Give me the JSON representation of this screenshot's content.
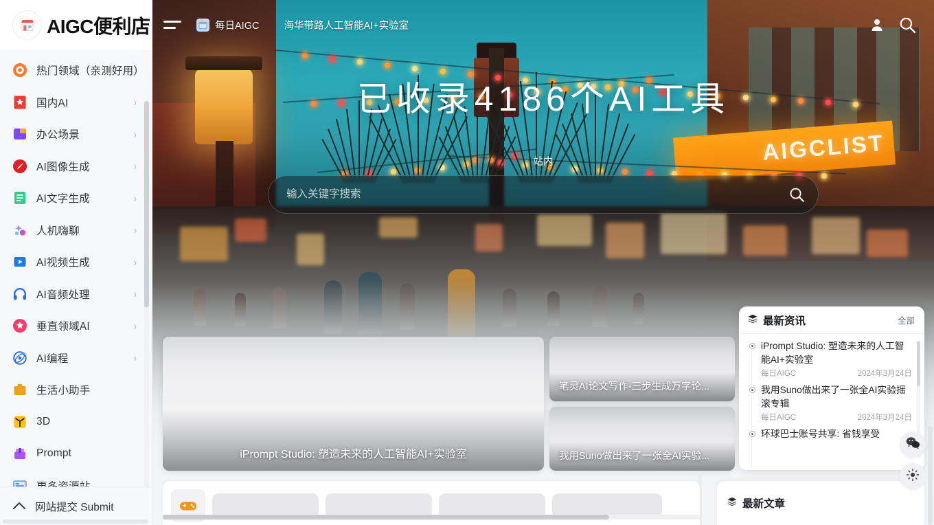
{
  "brand": {
    "logo_icon": "storefront-icon",
    "name": "AIGC便利店"
  },
  "sidebar": {
    "items": [
      {
        "label": "热门领域（亲测好用）",
        "icon": "hot-target-icon",
        "color": "#ff7a2f",
        "chevron": "›",
        "has_chevron": false
      },
      {
        "label": "国内AI",
        "icon": "star-bookmark-icon",
        "color": "#ef3b35",
        "chevron": "›",
        "has_chevron": true
      },
      {
        "label": "办公场景",
        "icon": "folder-icon",
        "color": "#7b4df0",
        "chevron": "›",
        "has_chevron": true
      },
      {
        "label": "AI图像生成",
        "icon": "paintbrush-icon",
        "color": "#e01f25",
        "chevron": "›",
        "has_chevron": true
      },
      {
        "label": "AI文字生成",
        "icon": "document-lines-icon",
        "color": "#2ecc84",
        "chevron": "›",
        "has_chevron": true
      },
      {
        "label": "人机嗨聊",
        "icon": "chat-sparkle-icon",
        "color": "#8d7fd8",
        "chevron": "›",
        "has_chevron": true
      },
      {
        "label": "AI视频生成",
        "icon": "video-play-icon",
        "color": "#1f7ae0",
        "chevron": "›",
        "has_chevron": true
      },
      {
        "label": "AI音频处理",
        "icon": "headphones-icon",
        "color": "#2f6fd8",
        "chevron": "›",
        "has_chevron": true
      },
      {
        "label": "垂直领域AI",
        "icon": "star-badge-icon",
        "color": "#f43f6e",
        "chevron": "›",
        "has_chevron": true
      },
      {
        "label": "AI编程",
        "icon": "atom-code-icon",
        "color": "#2f6fe0",
        "chevron": "›",
        "has_chevron": true
      },
      {
        "label": "生活小助手",
        "icon": "briefcase-icon",
        "color": "#f0a020",
        "chevron": "›",
        "has_chevron": false
      },
      {
        "label": "3D",
        "icon": "cube-icon",
        "color": "#fbbf24",
        "chevron": "›",
        "has_chevron": false
      },
      {
        "label": "Prompt",
        "icon": "box-stack-icon",
        "color": "#a855f7",
        "chevron": "›",
        "has_chevron": false
      },
      {
        "label": "更多资源站",
        "icon": "list-blue-icon",
        "color": "#3b82f6",
        "chevron": "›",
        "has_chevron": false
      }
    ],
    "submit": {
      "label": "网站提交 Submit",
      "icon": "chevron-up-icon"
    }
  },
  "topbar": {
    "menu_icon": "hamburger-menu-icon",
    "links": [
      {
        "label": "每日AIGC",
        "icon": "calendar-icon"
      },
      {
        "label": "海华带路人工智能AI+实验室",
        "icon": ""
      }
    ],
    "user_icon": "user-account-icon",
    "search_icon": "search-icon"
  },
  "hero": {
    "title": "已收录4186个AI工具",
    "tool_count": "4186",
    "search_scope_tab": "站内",
    "search_placeholder": "输入关键字搜索",
    "search_value": "",
    "search_button_icon": "search-icon",
    "signboard_text": "AIGCLIST"
  },
  "featured": {
    "big_card": {
      "caption": "iPrompt Studio: 塑造未来的人工智能AI+实验室"
    },
    "small_cards": [
      {
        "caption": "笔灵AI论文写作-三步生成万字论..."
      },
      {
        "caption": "我用Suno做出来了一张全AI实验..."
      }
    ]
  },
  "tagstrip": {
    "first_icon": "gamepad-icon",
    "skeleton_widths": [
      155,
      155,
      155,
      160
    ]
  },
  "news_panel": {
    "icon": "layers-icon",
    "title": "最新资讯",
    "all_label": "全部",
    "items": [
      {
        "title": "iPrompt Studio: 塑造未来的人工智能AI+实验室",
        "source": "每日AIGC",
        "date": "2024年3月24日"
      },
      {
        "title": "我用Suno做出来了一张全AI实验摇滚专辑",
        "source": "每日AIGC",
        "date": "2024年3月24日"
      },
      {
        "title": "环球巴士账号共享: 省钱享受",
        "source": "",
        "date": ""
      }
    ]
  },
  "latest_articles": {
    "icon": "layers-icon",
    "title": "最新文章"
  },
  "fabs": [
    {
      "name": "wechat-fab",
      "icon": "wechat-icon"
    },
    {
      "name": "brightness-fab",
      "icon": "brightness-icon"
    }
  ],
  "colors": {
    "hero_sky": "#2aa9b8",
    "awning": "#ffa417",
    "page_bg": "#f4f5f7",
    "sidebar_bg": "#f7f8fa"
  }
}
